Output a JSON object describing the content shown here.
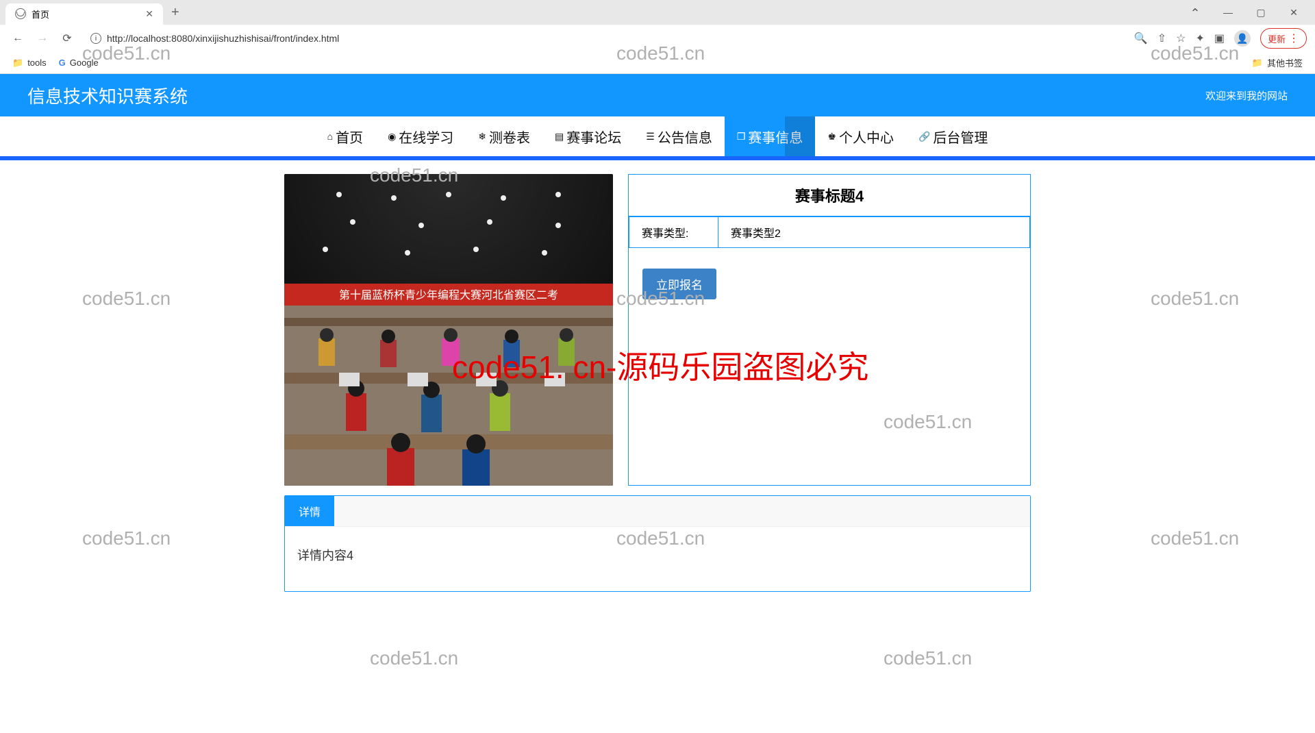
{
  "browser": {
    "tab_title": "首页",
    "url": "http://localhost:8080/xinxijishuzhishisai/front/index.html",
    "update_label": "更新",
    "bookmarks": {
      "tools": "tools",
      "google": "Google",
      "other": "其他书签"
    }
  },
  "header": {
    "site_title": "信息技术知识赛系统",
    "welcome": "欢迎来到我的网站"
  },
  "nav": {
    "home": "首页",
    "study": "在线学习",
    "test": "测卷表",
    "forum": "赛事论坛",
    "notice": "公告信息",
    "event": "赛事信息",
    "profile": "个人中心",
    "admin": "后台管理"
  },
  "event": {
    "title": "赛事标题4",
    "type_label": "赛事类型:",
    "type_value": "赛事类型2",
    "signup_label": "立即报名",
    "banner_text": "第十届蓝桥杯青少年编程大赛河北省赛区二考"
  },
  "detail": {
    "tab_label": "详情",
    "content": "详情内容4"
  },
  "watermark": {
    "text": "code51.cn",
    "red_text": "code51. cn-源码乐园盗图必究"
  }
}
